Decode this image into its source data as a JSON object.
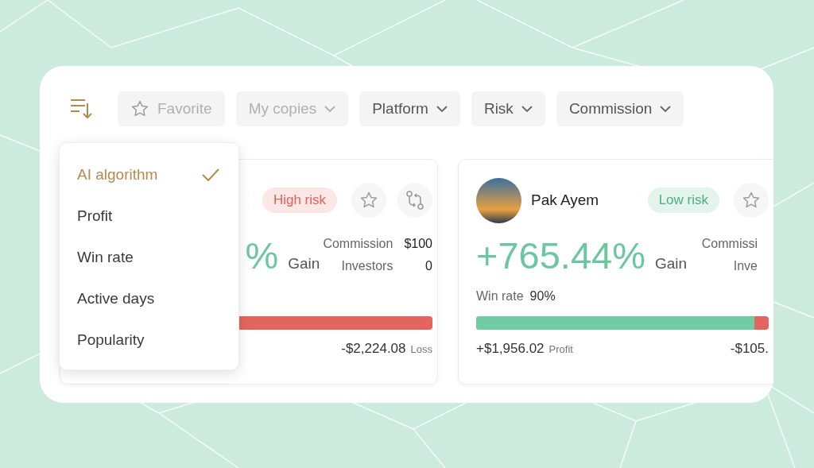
{
  "filters": [
    {
      "label": "Favorite",
      "kind": "toggle",
      "disabled": true
    },
    {
      "label": "My copies",
      "kind": "dropdown",
      "disabled": true
    },
    {
      "label": "Platform",
      "kind": "dropdown",
      "disabled": false
    },
    {
      "label": "Risk",
      "kind": "dropdown",
      "disabled": false
    },
    {
      "label": "Commission",
      "kind": "dropdown",
      "disabled": false
    }
  ],
  "sort_menu": {
    "items": [
      {
        "label": "AI algorithm",
        "selected": true
      },
      {
        "label": "Profit",
        "selected": false
      },
      {
        "label": "Win rate",
        "selected": false
      },
      {
        "label": "Active days",
        "selected": false
      },
      {
        "label": "Popularity",
        "selected": false
      }
    ]
  },
  "cards": [
    {
      "risk": {
        "label": "High risk",
        "kind": "high"
      },
      "actions": [
        {
          "kind": "star"
        },
        {
          "kind": "copy"
        }
      ],
      "gain": "%",
      "gain_label": "Gain",
      "stats": [
        {
          "label": "Commission",
          "value": "$100"
        },
        {
          "label": "Investors",
          "value": "0"
        }
      ],
      "level": 0,
      "loss": "-$2,224.08",
      "loss_label": "Loss"
    },
    {
      "name": "Pak Ayem",
      "risk": {
        "label": "Low risk",
        "kind": "low"
      },
      "actions": [
        {
          "kind": "star"
        }
      ],
      "gain": "+765.44%",
      "gain_label": "Gain",
      "stats": [
        {
          "label": "Commissi"
        },
        {
          "label": "Inve"
        }
      ],
      "win_rate_label": "Win rate",
      "win_rate": "90%",
      "level": 0.95,
      "profit": "+$1,956.02",
      "profit_label": "Profit",
      "loss": "-$105."
    }
  ]
}
